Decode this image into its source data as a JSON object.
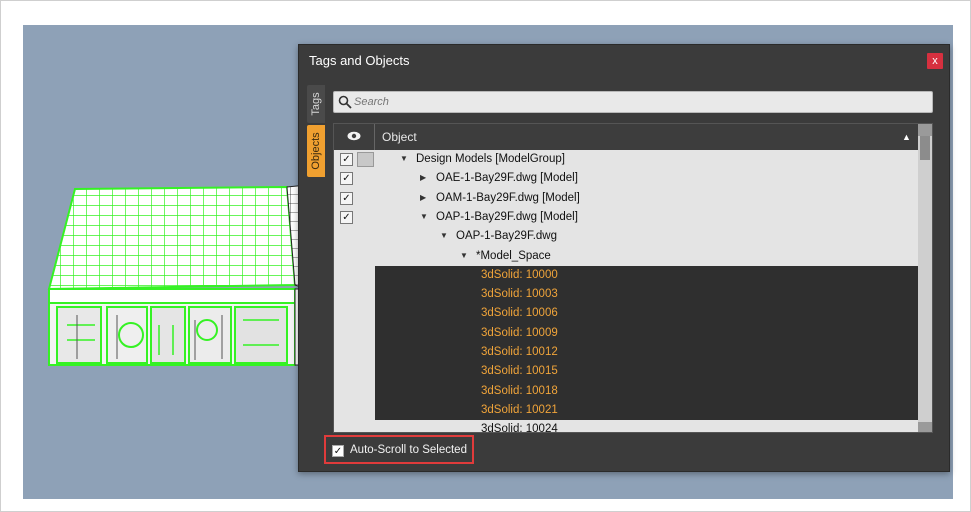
{
  "panel": {
    "title": "Tags and Objects",
    "close_glyph": "x",
    "tabs": [
      "Tags",
      "Objects"
    ],
    "active_tab": "Objects",
    "search_placeholder": "Search",
    "column_header": "Object",
    "sort_glyph": "▲",
    "autoscroll_label": "Auto-Scroll to Selected",
    "autoscroll_checked": true
  },
  "tree": [
    {
      "label": "Design Models [ModelGroup]",
      "checked": true,
      "arrow": "▼"
    },
    {
      "label": "OAE-1-Bay29F.dwg [Model]",
      "checked": true,
      "arrow": "▶"
    },
    {
      "label": "OAM-1-Bay29F.dwg [Model]",
      "checked": true,
      "arrow": "▶"
    },
    {
      "label": "OAP-1-Bay29F.dwg [Model]",
      "checked": true,
      "arrow": "▼"
    },
    {
      "label": "OAP-1-Bay29F.dwg",
      "arrow": "▼"
    },
    {
      "label": "*Model_Space",
      "arrow": "▼"
    },
    {
      "label": "3dSolid: 10000",
      "selected": true
    },
    {
      "label": "3dSolid: 10003",
      "selected": true
    },
    {
      "label": "3dSolid: 10006",
      "selected": true
    },
    {
      "label": "3dSolid: 10009",
      "selected": true
    },
    {
      "label": "3dSolid: 10012",
      "selected": true
    },
    {
      "label": "3dSolid: 10015",
      "selected": true
    },
    {
      "label": "3dSolid: 10018",
      "selected": true
    },
    {
      "label": "3dSolid: 10021",
      "selected": true
    },
    {
      "label": "3dSolid: 10024"
    }
  ],
  "icons": {
    "eye": "eye-icon",
    "search": "search-icon",
    "close": "close-icon"
  },
  "colors": {
    "accent": "#f0a030",
    "selected_text": "#f0a43a",
    "highlight_border": "#e03b3b",
    "viewport": "#8ea1b7",
    "model_wire": "#3cff28"
  }
}
